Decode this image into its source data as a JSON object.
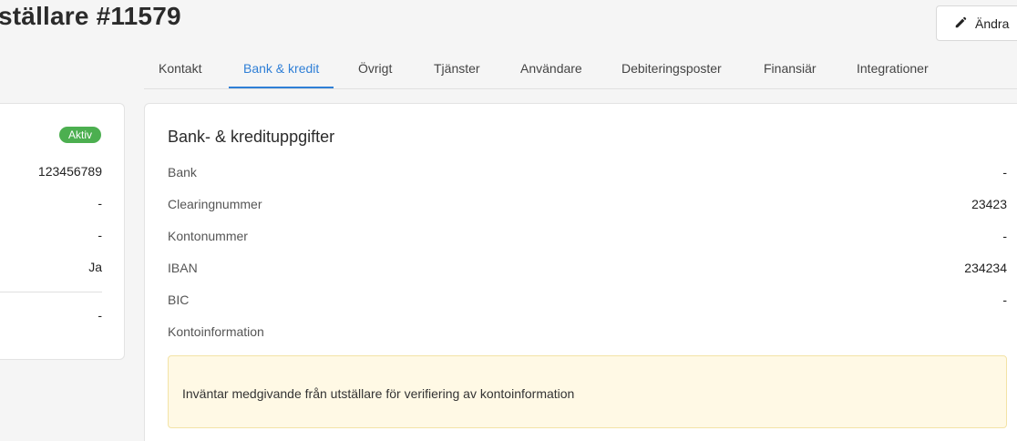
{
  "header": {
    "title": "ställare #11579",
    "edit_label": "Ändra"
  },
  "tabs": [
    {
      "label": "Kontakt"
    },
    {
      "label": "Bank & kredit"
    },
    {
      "label": "Övrigt"
    },
    {
      "label": "Tjänster"
    },
    {
      "label": "Användare"
    },
    {
      "label": "Debiteringsposter"
    },
    {
      "label": "Finansiär"
    },
    {
      "label": "Integrationer"
    }
  ],
  "summary": {
    "status": "Aktiv",
    "values": [
      "123456789",
      "-",
      "-",
      "Ja",
      "-"
    ]
  },
  "bank": {
    "title": "Bank- & kredituppgifter",
    "rows": [
      {
        "label": "Bank",
        "value": "-"
      },
      {
        "label": "Clearingnummer",
        "value": "23423"
      },
      {
        "label": "Kontonummer",
        "value": "-"
      },
      {
        "label": "IBAN",
        "value": "234234"
      },
      {
        "label": "BIC",
        "value": "-"
      },
      {
        "label": "Kontoinformation",
        "value": ""
      }
    ],
    "notice": "Inväntar medgivande från utställare för verifiering av kontoinformation"
  }
}
